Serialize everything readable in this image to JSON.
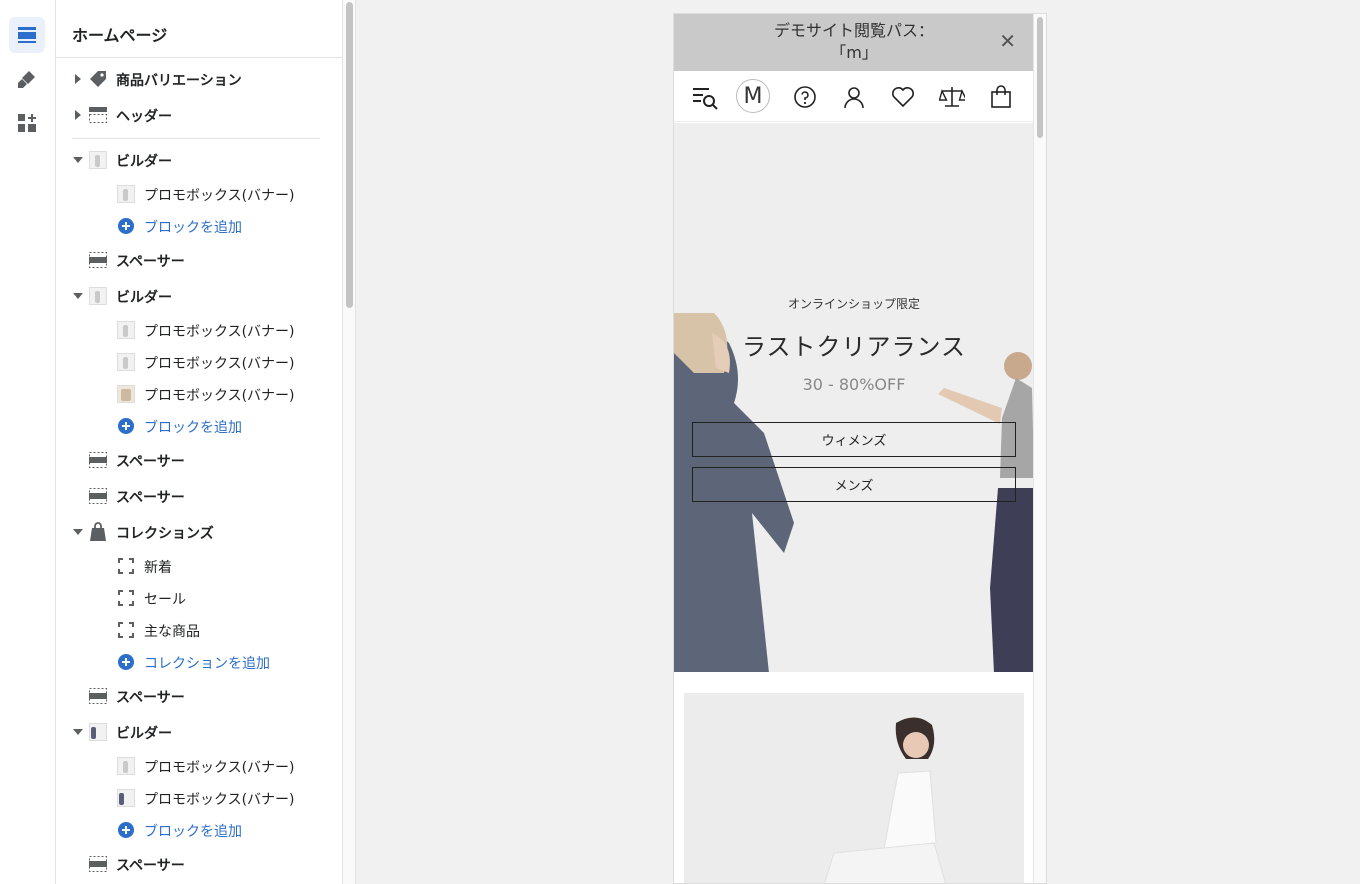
{
  "panel": {
    "title": "ホームページ",
    "sections": {
      "variations": "商品バリエーション",
      "header": "ヘッダー",
      "builder1": "ビルダー",
      "builder1_block": "プロモボックス(バナー)",
      "builder1_add": "ブロックを追加",
      "spacer1": "スペーサー",
      "builder2": "ビルダー",
      "builder2_block1": "プロモボックス(バナー)",
      "builder2_block2": "プロモボックス(バナー)",
      "builder2_block3": "プロモボックス(バナー)",
      "builder2_add": "ブロックを追加",
      "spacer2": "スペーサー",
      "spacer3": "スペーサー",
      "collections": "コレクションズ",
      "collection1": "新着",
      "collection2": "セール",
      "collection3": "主な商品",
      "collections_add": "コレクションを追加",
      "spacer4": "スペーサー",
      "builder3": "ビルダー",
      "builder3_block1": "プロモボックス(バナー)",
      "builder3_block2": "プロモボックス(バナー)",
      "builder3_add": "ブロックを追加",
      "spacer5": "スペーサー"
    }
  },
  "preview": {
    "announcement_line1": "デモサイト閲覧パス：",
    "announcement_line2": "「m」",
    "close_glyph": "✕",
    "logo_letter": "M",
    "hero": {
      "kicker": "オンラインショップ限定",
      "headline": "ラストクリアランス",
      "discount": "30 - 80%OFF",
      "button_women": "ウィメンズ",
      "button_men": "メンズ"
    }
  },
  "colors": {
    "accent": "#2c6ecb",
    "announcement_bg": "#c9c9c9",
    "hero_bg": "#eeeeee"
  }
}
